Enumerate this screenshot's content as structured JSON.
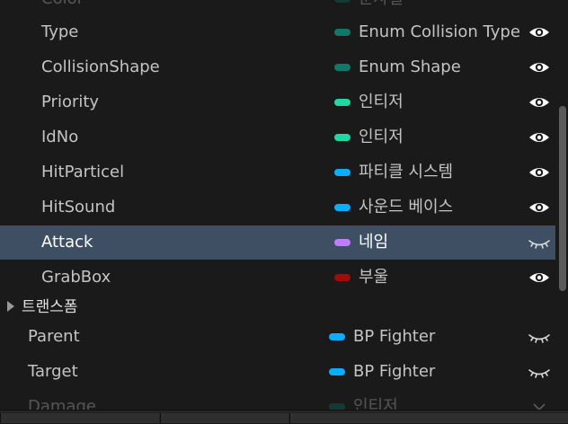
{
  "colors": {
    "enum": "#0f7869",
    "integer": "#21d7a4",
    "particle_system": "#0aaeff",
    "sound_base": "#0aaeff",
    "name": "#c17bff",
    "boolean": "#a00c0c",
    "object_ref": "#0aaeff"
  },
  "rows": [
    {
      "name": "Color",
      "type": "문자열",
      "pill": "#0f7869"
    },
    {
      "name": "Type",
      "type": "Enum Collision Type",
      "pill": "#0f7869",
      "visibility": "eye-open-icon"
    },
    {
      "name": "CollisionShape",
      "type": "Enum Shape",
      "pill": "#0f7869",
      "visibility": "eye-open-icon"
    },
    {
      "name": "Priority",
      "type": "인티저",
      "pill": "#21d7a4",
      "visibility": "eye-open-icon"
    },
    {
      "name": "IdNo",
      "type": "인티저",
      "pill": "#21d7a4",
      "visibility": "eye-open-icon"
    },
    {
      "name": "HitParticel",
      "type": "파티클 시스템",
      "pill": "#0aaeff",
      "visibility": "eye-open-icon"
    },
    {
      "name": "HitSound",
      "type": "사운드 베이스",
      "pill": "#0aaeff",
      "visibility": "eye-open-icon"
    },
    {
      "name": "Attack",
      "type": "네임",
      "pill": "#c17bff",
      "visibility": "eye-closed-icon",
      "selected": true
    },
    {
      "name": "GrabBox",
      "type": "부울",
      "pill": "#a00c0c",
      "visibility": "eye-open-icon"
    }
  ],
  "section": {
    "label": "트랜스폼",
    "expanded": false
  },
  "outer_rows": [
    {
      "name": "Parent",
      "type": "BP Fighter",
      "pill": "#0aaeff",
      "visibility": "eye-closed-icon"
    },
    {
      "name": "Target",
      "type": "BP Fighter",
      "pill": "#0aaeff",
      "visibility": "eye-closed-icon"
    },
    {
      "name": "Damage",
      "type": "인티저",
      "pill": "#0f7869",
      "visibility": "chevron-down-icon"
    }
  ]
}
